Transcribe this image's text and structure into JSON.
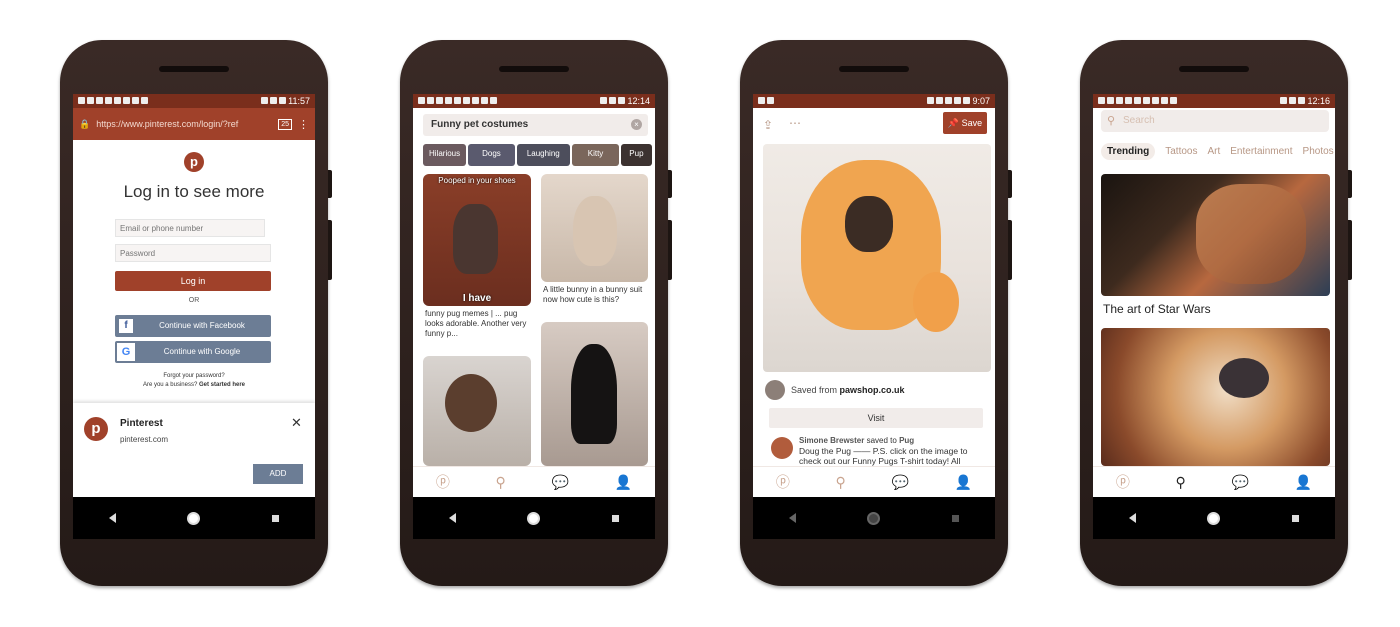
{
  "phone1": {
    "status_time": "11:57",
    "url": "https://www.pinterest.com/login/?ref",
    "tab_count": "25",
    "menu_icon": "more-vert-icon",
    "logo_icon": "pinterest-logo-icon",
    "heading": "Log in to see more",
    "email_placeholder": "Email or phone number",
    "password_placeholder": "Password",
    "login_button": "Log in",
    "or_text": "OR",
    "facebook_button": "Continue with Facebook",
    "google_button": "Continue with Google",
    "forgot_password": "Forgot your password?",
    "business_prompt": "Are you a business?",
    "get_started": "Get started here",
    "banner_title": "Pinterest",
    "banner_domain": "pinterest.com",
    "banner_add": "ADD"
  },
  "phone2": {
    "status_time": "12:14",
    "search_value": "Funny pet costumes",
    "chips": [
      "Hilarious",
      "Dogs",
      "Laughing",
      "Kitty",
      "Pup"
    ],
    "pin1_title_overlay": "Pooped in your shoes",
    "pin1_bottom_overlay": "I have",
    "pin1_caption": "funny pug memes | ... pug looks adorable. Another very funny p...",
    "pin2_caption": "A little bunny in a bunny suit now how cute is this?"
  },
  "phone3": {
    "status_time": "9:07",
    "save_button": "Save",
    "saved_from_prefix": "Saved from",
    "saved_from_site": "pawshop.co.uk",
    "visit_button": "Visit",
    "comment_user": "Simone Brewster",
    "comment_saved_to": "saved to",
    "comment_board": "Pug",
    "comment_text": "Doug the Pug —— P.S. click on the image to check out our Funny Pugs T-shirt today! All"
  },
  "phone4": {
    "status_time": "12:16",
    "search_placeholder": "Search",
    "tabs": [
      "Trending",
      "Tattoos",
      "Art",
      "Entertainment",
      "Photos"
    ],
    "card1_title": "The art of Star Wars"
  },
  "colors": {
    "brand": "#a0412a",
    "status_bar": "#7a2e1c",
    "facebook": "#6c7d95"
  }
}
